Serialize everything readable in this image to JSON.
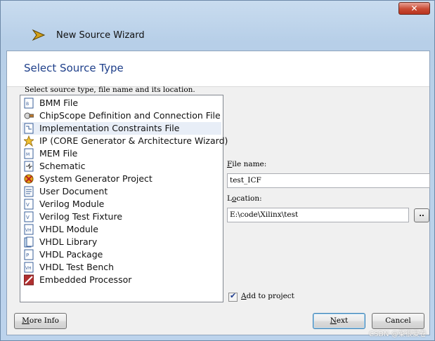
{
  "window": {
    "title": "New Source Wizard",
    "close_label": "✕"
  },
  "page": {
    "title": "Select Source Type",
    "instruction": "Select source type, file name and its location."
  },
  "source_types": [
    {
      "label": "BMM File",
      "icon": "bmm-file-icon"
    },
    {
      "label": "ChipScope Definition and Connection File",
      "icon": "chipscope-icon"
    },
    {
      "label": "Implementation Constraints File",
      "icon": "constraints-file-icon",
      "selected": true
    },
    {
      "label": "IP (CORE Generator & Architecture Wizard)",
      "icon": "ip-core-icon"
    },
    {
      "label": "MEM File",
      "icon": "mem-file-icon"
    },
    {
      "label": "Schematic",
      "icon": "schematic-icon"
    },
    {
      "label": "System Generator Project",
      "icon": "system-generator-icon"
    },
    {
      "label": "User Document",
      "icon": "document-icon"
    },
    {
      "label": "Verilog Module",
      "icon": "verilog-module-icon"
    },
    {
      "label": "Verilog Test Fixture",
      "icon": "verilog-test-icon"
    },
    {
      "label": "VHDL Module",
      "icon": "vhdl-module-icon"
    },
    {
      "label": "VHDL Library",
      "icon": "vhdl-library-icon"
    },
    {
      "label": "VHDL Package",
      "icon": "vhdl-package-icon"
    },
    {
      "label": "VHDL Test Bench",
      "icon": "vhdl-testbench-icon"
    },
    {
      "label": "Embedded Processor",
      "icon": "embedded-processor-icon"
    }
  ],
  "file_name": {
    "label_accel": "F",
    "label_rest": "ile name:",
    "value": "test_ICF"
  },
  "location": {
    "label_pre": "L",
    "label_accel": "o",
    "label_rest": "cation:",
    "value": "E:\\code\\Xilinx\\test",
    "browse_label": ".."
  },
  "add_to_project": {
    "label_accel": "A",
    "label_rest": "dd to project",
    "checked": true
  },
  "buttons": {
    "more_info_accel": "M",
    "more_info_rest": "ore Info",
    "next_accel": "N",
    "next_rest": "ext",
    "cancel": "Cancel"
  },
  "watermark": "CSDN @菜很爱卷"
}
